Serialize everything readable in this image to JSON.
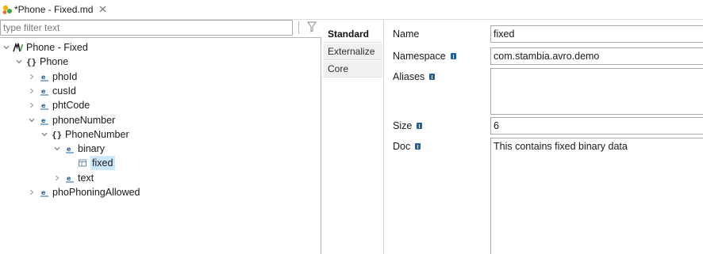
{
  "editor_tab": {
    "title": "*Phone - Fixed.md",
    "icon": "stambia-metadata-icon"
  },
  "filter": {
    "placeholder": "type filter text",
    "icon": "filter-funnel-icon"
  },
  "tree": [
    {
      "label": "Phone - Fixed",
      "icon": "avro-root-icon",
      "expanded": true
    },
    {
      "label": "Phone",
      "icon": "record-braces-icon",
      "expanded": true
    },
    {
      "label": "phoId",
      "icon": "field-e-icon",
      "expanded": false
    },
    {
      "label": "cusId",
      "icon": "field-e-icon",
      "expanded": false
    },
    {
      "label": "phtCode",
      "icon": "field-e-icon",
      "expanded": false
    },
    {
      "label": "phoneNumber",
      "icon": "field-e-icon",
      "expanded": true
    },
    {
      "label": "PhoneNumber",
      "icon": "record-braces-icon",
      "expanded": true
    },
    {
      "label": "binary",
      "icon": "field-e-icon",
      "expanded": true
    },
    {
      "label": "fixed",
      "icon": "fixed-type-icon",
      "selected": true
    },
    {
      "label": "text",
      "icon": "field-e-icon",
      "expanded": false
    },
    {
      "label": "phoPhoningAllowed",
      "icon": "field-e-icon",
      "expanded": false
    }
  ],
  "side_tabs": [
    "Standard",
    "Externalize",
    "Core"
  ],
  "active_side_tab": "Standard",
  "properties": {
    "name": {
      "label": "Name",
      "value": "fixed"
    },
    "namespace": {
      "label": "Namespace",
      "value": "com.stambia.avro.demo"
    },
    "aliases": {
      "label": "Aliases",
      "value": ""
    },
    "size": {
      "label": "Size",
      "value": "6"
    },
    "doc": {
      "label": "Doc",
      "value": "This contains fixed binary data"
    }
  },
  "colors": {
    "selection": "#cce8ff",
    "info_icon": "#1f5fa8",
    "field_icon": "#1f5fa8"
  }
}
